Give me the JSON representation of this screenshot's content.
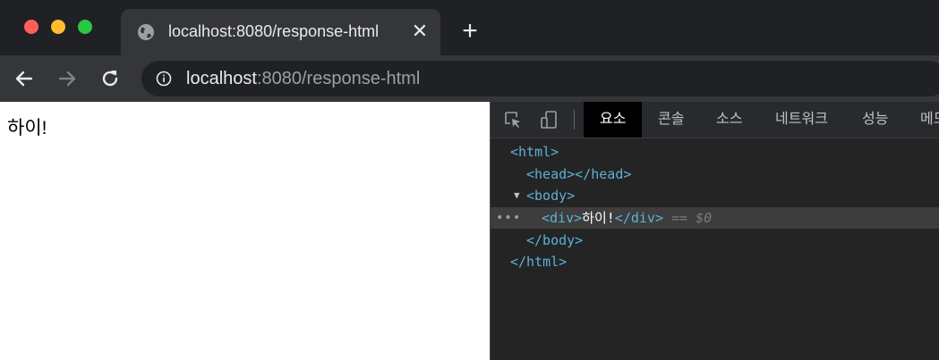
{
  "tab": {
    "title": "localhost:8080/response-html",
    "close_glyph": "✕",
    "new_tab_glyph": "+"
  },
  "toolbar": {
    "url_host": "localhost",
    "url_path": ":8080/response-html"
  },
  "page": {
    "content": "하이!"
  },
  "devtools": {
    "tabs": [
      {
        "label": "요소",
        "active": true
      },
      {
        "label": "콘솔",
        "active": false
      },
      {
        "label": "소스",
        "active": false
      },
      {
        "label": "네트워크",
        "active": false
      },
      {
        "label": "성능",
        "active": false
      },
      {
        "label": "메모",
        "active": false
      }
    ],
    "dom": {
      "html_open": "<html>",
      "head": "<head></head>",
      "body_open": "<body>",
      "div_open": "<div>",
      "div_text": "하이!",
      "div_close": "</div>",
      "selected_marker_eq": "==",
      "selected_marker_var": "$0",
      "body_close": "</body>",
      "html_close": "</html>",
      "ellipsis": "•••"
    }
  },
  "colors": {
    "tag": "#5db0d7",
    "close_red": "#ff5f57",
    "minimize_yellow": "#febc2e",
    "zoom_green": "#28c840"
  },
  "icons": [
    "globe-icon",
    "close-icon",
    "plus-icon",
    "back-arrow-icon",
    "forward-arrow-icon",
    "reload-icon",
    "info-icon",
    "inspect-element-icon",
    "device-toolbar-icon"
  ]
}
